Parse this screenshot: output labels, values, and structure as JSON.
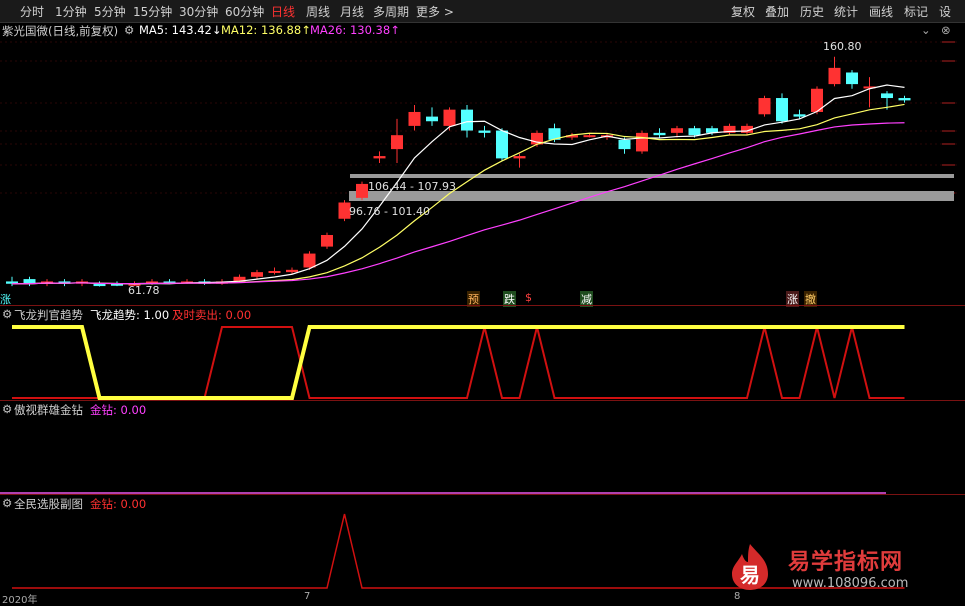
{
  "toolbar": {
    "left": [
      "分时",
      "1分钟",
      "5分钟",
      "15分钟",
      "30分钟",
      "60分钟",
      "日线",
      "周线",
      "月线",
      "多周期",
      "更多 >"
    ],
    "active": "日线",
    "right": [
      "复权",
      "叠加",
      "历史",
      "统计",
      "画线",
      "标记",
      "设"
    ]
  },
  "chart_title": {
    "name": "紫光国微(日线,前复权)",
    "ma5": "MA5: 143.42↓",
    "ma12": "MA12: 136.88↑",
    "ma26": "MA26: 130.38↑"
  },
  "annotations": {
    "high": "160.80",
    "low": "61.78",
    "zone1": "106.44 - 107.93",
    "zone2": "96.76 - 101.40",
    "left_tag": "涨",
    "signals": [
      "预",
      "跌",
      "$",
      "减",
      "涨",
      "撤"
    ]
  },
  "indicator1": {
    "name": "飞龙判官趋势",
    "series1": "飞龙趋势: 1.00",
    "series2": "及时卖出: 0.00"
  },
  "indicator2": {
    "name": "傲视群雄金钻",
    "series1": "金钻: 0.00"
  },
  "indicator3": {
    "name": "全民选股副图",
    "series1": "金钻: 0.00"
  },
  "x_axis": [
    "2020年",
    "7",
    "8"
  ],
  "watermark": {
    "logo_char": "易",
    "title": "易学指标网",
    "url": "www.108096.com"
  },
  "colors": {
    "up": "#ff3232",
    "down": "#54ffff",
    "ma5": "#ffffff",
    "ma12": "#ffff66",
    "ma26": "#ff40ff",
    "trend": "#ffff40",
    "sell": "#d01010"
  },
  "chart_data": {
    "type": "candlestick",
    "candles": [
      {
        "o": 64,
        "c": 63,
        "h": 66,
        "l": 62,
        "dir": "down"
      },
      {
        "o": 65,
        "c": 63,
        "h": 66,
        "l": 62,
        "dir": "down"
      },
      {
        "o": 63,
        "c": 64,
        "h": 65,
        "l": 62,
        "dir": "up"
      },
      {
        "o": 64,
        "c": 63,
        "h": 65,
        "l": 62,
        "dir": "down"
      },
      {
        "o": 63,
        "c": 64,
        "h": 65,
        "l": 62,
        "dir": "up"
      },
      {
        "o": 63,
        "c": 62,
        "h": 64,
        "l": 61.8,
        "dir": "down"
      },
      {
        "o": 63,
        "c": 62.5,
        "h": 64,
        "l": 62,
        "dir": "down"
      },
      {
        "o": 62.5,
        "c": 63,
        "h": 64,
        "l": 62,
        "dir": "up"
      },
      {
        "o": 63,
        "c": 64,
        "h": 65,
        "l": 62.5,
        "dir": "up"
      },
      {
        "o": 64,
        "c": 63.5,
        "h": 65,
        "l": 63,
        "dir": "down"
      },
      {
        "o": 63.5,
        "c": 64,
        "h": 65,
        "l": 63,
        "dir": "up"
      },
      {
        "o": 64,
        "c": 63,
        "h": 65,
        "l": 62.5,
        "dir": "down"
      },
      {
        "o": 63,
        "c": 64,
        "h": 65,
        "l": 62.5,
        "dir": "up"
      },
      {
        "o": 64,
        "c": 66,
        "h": 67,
        "l": 63.5,
        "dir": "up"
      },
      {
        "o": 66,
        "c": 68,
        "h": 69,
        "l": 65,
        "dir": "up"
      },
      {
        "o": 68,
        "c": 68.5,
        "h": 70,
        "l": 67,
        "dir": "up"
      },
      {
        "o": 68,
        "c": 69,
        "h": 70,
        "l": 67,
        "dir": "up"
      },
      {
        "o": 70,
        "c": 76,
        "h": 77,
        "l": 69,
        "dir": "up"
      },
      {
        "o": 79,
        "c": 84,
        "h": 85,
        "l": 78,
        "dir": "up"
      },
      {
        "o": 91,
        "c": 98,
        "h": 99,
        "l": 90,
        "dir": "up"
      },
      {
        "o": 100,
        "c": 106,
        "h": 107,
        "l": 99,
        "dir": "up"
      },
      {
        "o": 117,
        "c": 118,
        "h": 120,
        "l": 115,
        "dir": "up"
      },
      {
        "o": 121,
        "c": 127,
        "h": 134,
        "l": 115,
        "dir": "up"
      },
      {
        "o": 131,
        "c": 137,
        "h": 140,
        "l": 129,
        "dir": "up"
      },
      {
        "o": 135,
        "c": 133,
        "h": 139,
        "l": 131,
        "dir": "down"
      },
      {
        "o": 131,
        "c": 138,
        "h": 139,
        "l": 129,
        "dir": "up"
      },
      {
        "o": 138,
        "c": 129,
        "h": 140,
        "l": 126,
        "dir": "down"
      },
      {
        "o": 129,
        "c": 128,
        "h": 131,
        "l": 126,
        "dir": "down"
      },
      {
        "o": 129,
        "c": 117,
        "h": 130,
        "l": 116,
        "dir": "down"
      },
      {
        "o": 117,
        "c": 118,
        "h": 119,
        "l": 113,
        "dir": "up"
      },
      {
        "o": 123,
        "c": 128,
        "h": 129,
        "l": 122,
        "dir": "up"
      },
      {
        "o": 130,
        "c": 125,
        "h": 132,
        "l": 124,
        "dir": "down"
      },
      {
        "o": 126,
        "c": 127,
        "h": 128,
        "l": 125,
        "dir": "up"
      },
      {
        "o": 127,
        "c": 127,
        "h": 128,
        "l": 126,
        "dir": "up"
      },
      {
        "o": 127,
        "c": 126,
        "h": 128,
        "l": 125,
        "dir": "up"
      },
      {
        "o": 125,
        "c": 121,
        "h": 126,
        "l": 119,
        "dir": "down"
      },
      {
        "o": 120,
        "c": 128,
        "h": 129,
        "l": 119,
        "dir": "up"
      },
      {
        "o": 128,
        "c": 127,
        "h": 130,
        "l": 126,
        "dir": "down"
      },
      {
        "o": 128,
        "c": 130,
        "h": 131,
        "l": 126,
        "dir": "up"
      },
      {
        "o": 130,
        "c": 127,
        "h": 131,
        "l": 126,
        "dir": "down"
      },
      {
        "o": 130,
        "c": 128,
        "h": 131,
        "l": 127,
        "dir": "down"
      },
      {
        "o": 128,
        "c": 131,
        "h": 132,
        "l": 127,
        "dir": "up"
      },
      {
        "o": 131,
        "c": 128,
        "h": 132,
        "l": 127,
        "dir": "up"
      },
      {
        "o": 136,
        "c": 143,
        "h": 144,
        "l": 135,
        "dir": "up"
      },
      {
        "o": 143,
        "c": 133,
        "h": 145,
        "l": 132,
        "dir": "down"
      },
      {
        "o": 136,
        "c": 135,
        "h": 138,
        "l": 134,
        "dir": "down"
      },
      {
        "o": 137,
        "c": 147,
        "h": 148,
        "l": 136,
        "dir": "up"
      },
      {
        "o": 149,
        "c": 156,
        "h": 160.8,
        "l": 148,
        "dir": "up"
      },
      {
        "o": 154,
        "c": 149,
        "h": 155,
        "l": 147,
        "dir": "down"
      },
      {
        "o": 148,
        "c": 148,
        "h": 152,
        "l": 139,
        "dir": "up"
      },
      {
        "o": 145,
        "c": 143,
        "h": 146,
        "l": 138,
        "dir": "down"
      },
      {
        "o": 143,
        "c": 142,
        "h": 144,
        "l": 141,
        "dir": "down"
      }
    ],
    "trend_line": [
      1,
      1,
      1,
      1,
      1,
      0,
      0,
      0,
      0,
      0,
      0,
      0,
      0,
      0,
      0,
      0,
      0,
      1,
      1,
      1,
      1,
      1,
      1,
      1,
      1,
      1,
      1,
      1,
      1,
      1,
      1,
      1,
      1,
      1,
      1,
      1,
      1,
      1,
      1,
      1,
      1,
      1,
      1,
      1,
      1,
      1,
      1,
      1,
      1,
      1,
      1,
      1
    ],
    "sell_line": [
      0,
      0,
      0,
      0,
      0,
      0,
      0,
      0,
      0,
      0,
      0,
      0,
      1,
      1,
      1,
      1,
      1,
      0,
      0,
      0,
      0,
      0,
      0,
      0,
      0,
      0,
      0,
      1,
      0,
      0,
      1,
      0,
      0,
      0,
      0,
      0,
      0,
      0,
      0,
      0,
      0,
      0,
      0,
      1,
      0,
      0,
      1,
      0,
      1,
      0,
      0,
      0
    ],
    "sub3_spike": [
      0,
      0,
      0,
      0,
      0,
      0,
      0,
      0,
      0,
      0,
      0,
      0,
      0,
      0,
      0,
      0,
      0,
      0,
      0,
      1,
      0,
      0,
      0,
      0,
      0,
      0,
      0,
      0,
      0,
      0,
      0,
      0,
      0,
      0,
      0,
      0,
      0,
      0,
      0,
      0,
      0,
      0,
      0,
      0,
      0,
      0,
      0,
      0,
      0,
      0,
      0,
      0
    ]
  }
}
